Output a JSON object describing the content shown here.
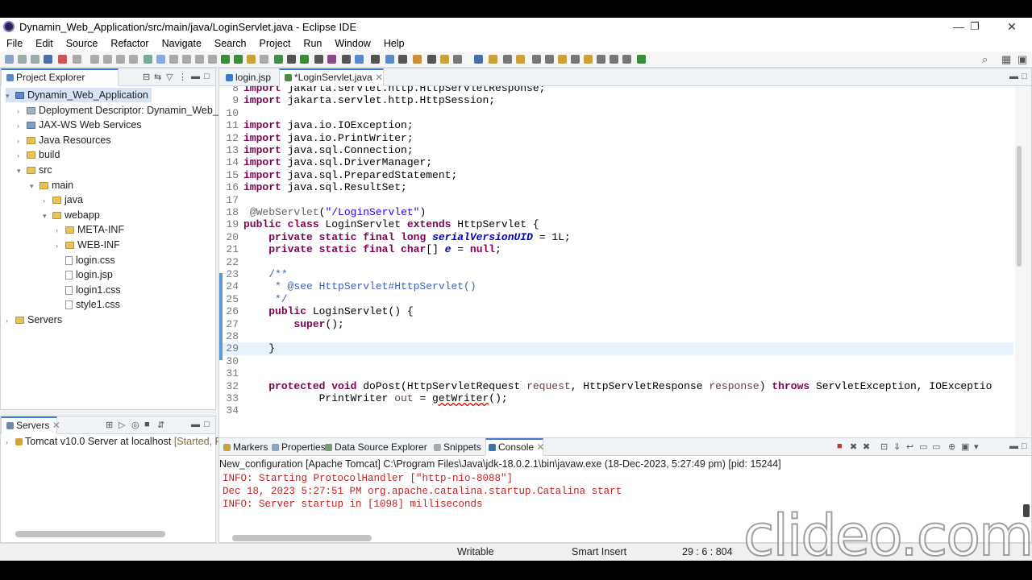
{
  "window": {
    "title": "Dynamin_Web_Application/src/main/java/LoginServlet.java - Eclipse IDE"
  },
  "menu": [
    "File",
    "Edit",
    "Source",
    "Refactor",
    "Navigate",
    "Search",
    "Project",
    "Run",
    "Window",
    "Help"
  ],
  "project_explorer": {
    "tab_label": "Project Explorer",
    "items": [
      {
        "label": "Dynamin_Web_Application",
        "icon": "project-icon",
        "twisty": "▾",
        "selected": true
      },
      {
        "label": "Deployment Descriptor: Dynamin_Web_A",
        "icon": "descriptor-icon",
        "twisty": "›"
      },
      {
        "label": "JAX-WS Web Services",
        "icon": "webservices-icon",
        "twisty": "›"
      },
      {
        "label": "Java Resources",
        "icon": "java-resources-icon",
        "twisty": "›"
      },
      {
        "label": "build",
        "icon": "folder-icon",
        "twisty": "›"
      },
      {
        "label": "src",
        "icon": "folder-icon",
        "twisty": "▾"
      },
      {
        "label": "main",
        "icon": "folder-icon",
        "twisty": "▾"
      },
      {
        "label": "java",
        "icon": "folder-icon",
        "twisty": "›"
      },
      {
        "label": "webapp",
        "icon": "folder-icon",
        "twisty": "▾"
      },
      {
        "label": "META-INF",
        "icon": "folder-icon",
        "twisty": "›"
      },
      {
        "label": "WEB-INF",
        "icon": "folder-icon",
        "twisty": "›"
      },
      {
        "label": "login.css",
        "icon": "file-icon",
        "twisty": ""
      },
      {
        "label": "login.jsp",
        "icon": "file-icon",
        "twisty": ""
      },
      {
        "label": "login1.css",
        "icon": "file-icon",
        "twisty": ""
      },
      {
        "label": "style1.css",
        "icon": "file-icon",
        "twisty": ""
      },
      {
        "label": "Servers",
        "icon": "folder-icon",
        "twisty": "›"
      }
    ]
  },
  "servers": {
    "tab_label": "Servers",
    "items": [
      {
        "label": "Tomcat v10.0 Server at localhost",
        "state": "[Started, Re"
      }
    ]
  },
  "editor": {
    "tabs": [
      {
        "label": "login.jsp"
      },
      {
        "label": "*LoginServlet.java"
      }
    ],
    "lines": [
      {
        "n": "8",
        "html": "<span class=\"kw\">import</span> jakarta.servlet.http.HttpServletResponse;"
      },
      {
        "n": "9",
        "html": "<span class=\"kw\">import</span> jakarta.servlet.http.HttpSession;"
      },
      {
        "n": "10",
        "html": ""
      },
      {
        "n": "11",
        "html": "<span class=\"kw\">import</span> java.io.IOException;"
      },
      {
        "n": "12",
        "html": "<span class=\"kw\">import</span> java.io.PrintWriter;"
      },
      {
        "n": "13",
        "html": "<span class=\"kw\">import</span> java.sql.Connection;"
      },
      {
        "n": "14",
        "html": "<span class=\"kw\">import</span> java.sql.DriverManager;"
      },
      {
        "n": "15",
        "html": "<span class=\"kw\">import</span> java.sql.PreparedStatement;"
      },
      {
        "n": "16",
        "html": "<span class=\"kw\">import</span> java.sql.ResultSet;"
      },
      {
        "n": "17",
        "html": ""
      },
      {
        "n": "18",
        "html": " <span class=\"ann\">@WebServlet</span>(<span class=\"str\">\"/LoginServlet\"</span>)"
      },
      {
        "n": "19",
        "html": "<span class=\"kw\">public class</span> LoginServlet <span class=\"kw\">extends</span> HttpServlet {"
      },
      {
        "n": "20",
        "html": "    <span class=\"kw\">private static final long</span> <span class=\"fld\">serialVersionUID</span> = 1L;"
      },
      {
        "n": "21",
        "html": "    <span class=\"kw\">private static final char</span>[] <span class=\"fld\">e</span> = <span class=\"kw\">null</span>;"
      },
      {
        "n": "22",
        "html": ""
      },
      {
        "n": "23",
        "html": "    <span class=\"cmt\">/**</span>"
      },
      {
        "n": "24",
        "html": "<span class=\"cmt\">     * @see HttpServlet#HttpServlet()</span>"
      },
      {
        "n": "25",
        "html": "<span class=\"cmt\">     */</span>"
      },
      {
        "n": "26",
        "html": "    <span class=\"kw\">public</span> LoginServlet() {"
      },
      {
        "n": "27",
        "html": "        <span class=\"kw\">super</span>();"
      },
      {
        "n": "28",
        "html": ""
      },
      {
        "n": "29",
        "html": "    }"
      },
      {
        "n": "30",
        "html": ""
      },
      {
        "n": "31",
        "html": ""
      },
      {
        "n": "32",
        "html": "    <span class=\"kw\">protected void</span> doPost(HttpServletRequest <span class=\"par\">request</span>, HttpServletResponse <span class=\"par\">response</span>) <span class=\"kw\">throws</span> ServletException, IOExceptio"
      },
      {
        "n": "33",
        "html": "            PrintWriter <span class=\"par\">out</span> = <span style=\"text-decoration:underline wavy #d00\">getWriter</span>();"
      },
      {
        "n": "34",
        "html": ""
      }
    ]
  },
  "bottom_tabs": [
    {
      "label": "Markers"
    },
    {
      "label": "Properties"
    },
    {
      "label": "Data Source Explorer"
    },
    {
      "label": "Snippets"
    },
    {
      "label": "Console"
    }
  ],
  "console": {
    "header": "New_configuration [Apache Tomcat] C:\\Program Files\\Java\\jdk-18.0.2.1\\bin\\javaw.exe  (18-Dec-2023, 5:27:49 pm) [pid: 15244]",
    "lines": [
      "INFO: Starting ProtocolHandler [\"http-nio-8088\"]",
      "Dec 18, 2023 5:27:51 PM org.apache.catalina.startup.Catalina start",
      "INFO: Server startup in [1098] milliseconds"
    ]
  },
  "status": {
    "writable": "Writable",
    "insert_mode": "Smart Insert",
    "position": "29 : 6 : 804"
  },
  "watermark": "clideo.com"
}
